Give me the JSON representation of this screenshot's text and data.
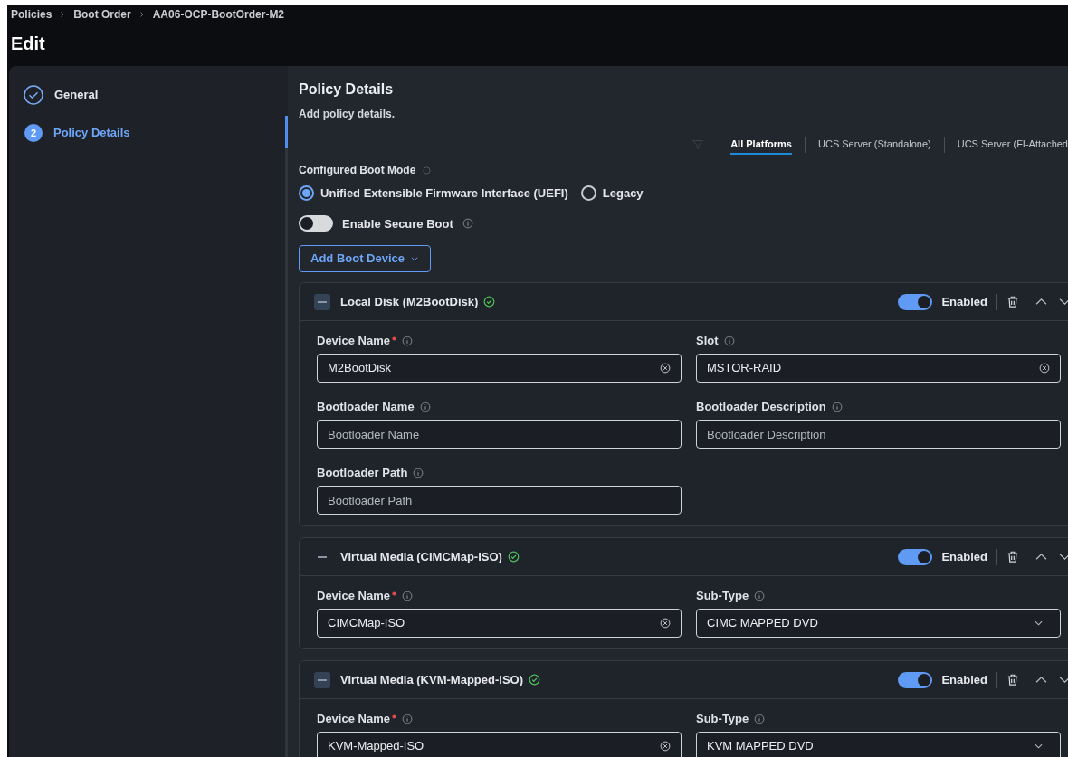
{
  "breadcrumb": [
    "Policies",
    "Boot Order",
    "AA06-OCP-BootOrder-M2"
  ],
  "title": "Edit",
  "steps": [
    {
      "label": "General",
      "done": true,
      "selected": false
    },
    {
      "number": "2",
      "label": "Policy Details",
      "done": false,
      "selected": true
    }
  ],
  "section": {
    "title": "Policy Details",
    "subtitle": "Add policy details."
  },
  "platform_tabs": [
    {
      "label": "All Platforms",
      "selected": true
    },
    {
      "label": "UCS Server (Standalone)",
      "selected": false
    },
    {
      "label": "UCS Server (FI-Attached",
      "selected": false
    }
  ],
  "boot_mode": {
    "label": "Configured Boot Mode",
    "options": [
      {
        "label": "Unified Extensible Firmware Interface (UEFI)",
        "selected": true
      },
      {
        "label": "Legacy",
        "selected": false
      }
    ]
  },
  "secure_boot": {
    "label": "Enable Secure Boot",
    "on": false
  },
  "add_button": "Add Boot Device",
  "devices": [
    {
      "title": "Local Disk (M2BootDisk)",
      "collapse_boxed": true,
      "enabled": true,
      "toggle_label": "Enabled",
      "fields": [
        {
          "kind": "text",
          "label": "Device Name",
          "required": true,
          "value": "M2BootDisk"
        },
        {
          "kind": "text",
          "label": "Slot",
          "required": false,
          "value": "MSTOR-RAID"
        },
        {
          "kind": "empty",
          "label": "Bootloader Name",
          "required": false,
          "placeholder": "Bootloader Name"
        },
        {
          "kind": "empty",
          "label": "Bootloader Description",
          "required": false,
          "placeholder": "Bootloader Description"
        },
        {
          "kind": "empty",
          "label": "Bootloader Path",
          "required": false,
          "placeholder": "Bootloader Path"
        }
      ]
    },
    {
      "title": "Virtual Media (CIMCMap-ISO)",
      "collapse_boxed": false,
      "enabled": true,
      "toggle_label": "Enabled",
      "fields": [
        {
          "kind": "text",
          "label": "Device Name",
          "required": true,
          "value": "CIMCMap-ISO"
        },
        {
          "kind": "select",
          "label": "Sub-Type",
          "required": false,
          "value": "CIMC MAPPED DVD"
        }
      ]
    },
    {
      "title": "Virtual Media (KVM-Mapped-ISO)",
      "collapse_boxed": true,
      "enabled": true,
      "toggle_label": "Enabled",
      "fields": [
        {
          "kind": "text",
          "label": "Device Name",
          "required": true,
          "value": "KVM-Mapped-ISO"
        },
        {
          "kind": "select",
          "label": "Sub-Type",
          "required": false,
          "value": "KVM MAPPED DVD"
        }
      ]
    }
  ]
}
